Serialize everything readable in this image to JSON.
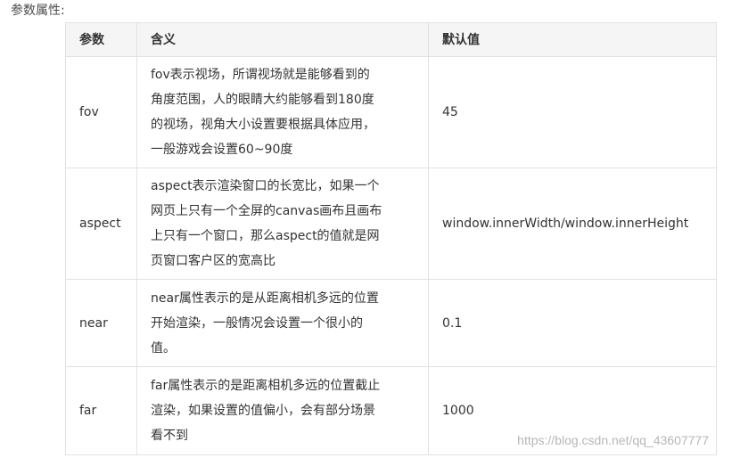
{
  "section_label": "参数属性:",
  "table": {
    "headers": [
      "参数",
      "含义",
      "默认值"
    ],
    "rows": [
      {
        "param": "fov",
        "desc_lines": [
          "fov表示视场，所谓视场就是能够看到的",
          "角度范围，人的眼睛大约能够看到180度",
          "的视场，视角大小设置要根据具体应用，",
          "一般游戏会设置60~90度"
        ],
        "default": "45"
      },
      {
        "param": "aspect",
        "desc_lines": [
          "aspect表示渲染窗口的长宽比，如果一个",
          "网页上只有一个全屏的canvas画布且画布",
          "上只有一个窗口，那么aspect的值就是网",
          "页窗口客户区的宽高比"
        ],
        "default": "window.innerWidth/window.innerHeight"
      },
      {
        "param": "near",
        "desc_lines": [
          "near属性表示的是从距离相机多远的位置",
          "开始渲染，一般情况会设置一个很小的",
          "值。"
        ],
        "default": "0.1"
      },
      {
        "param": "far",
        "desc_lines": [
          "far属性表示的是距离相机多远的位置截止",
          "渲染，如果设置的值偏小，会有部分场景",
          "看不到"
        ],
        "default": "1000"
      }
    ]
  },
  "watermark": "https://blog.csdn.net/qq_43607777"
}
